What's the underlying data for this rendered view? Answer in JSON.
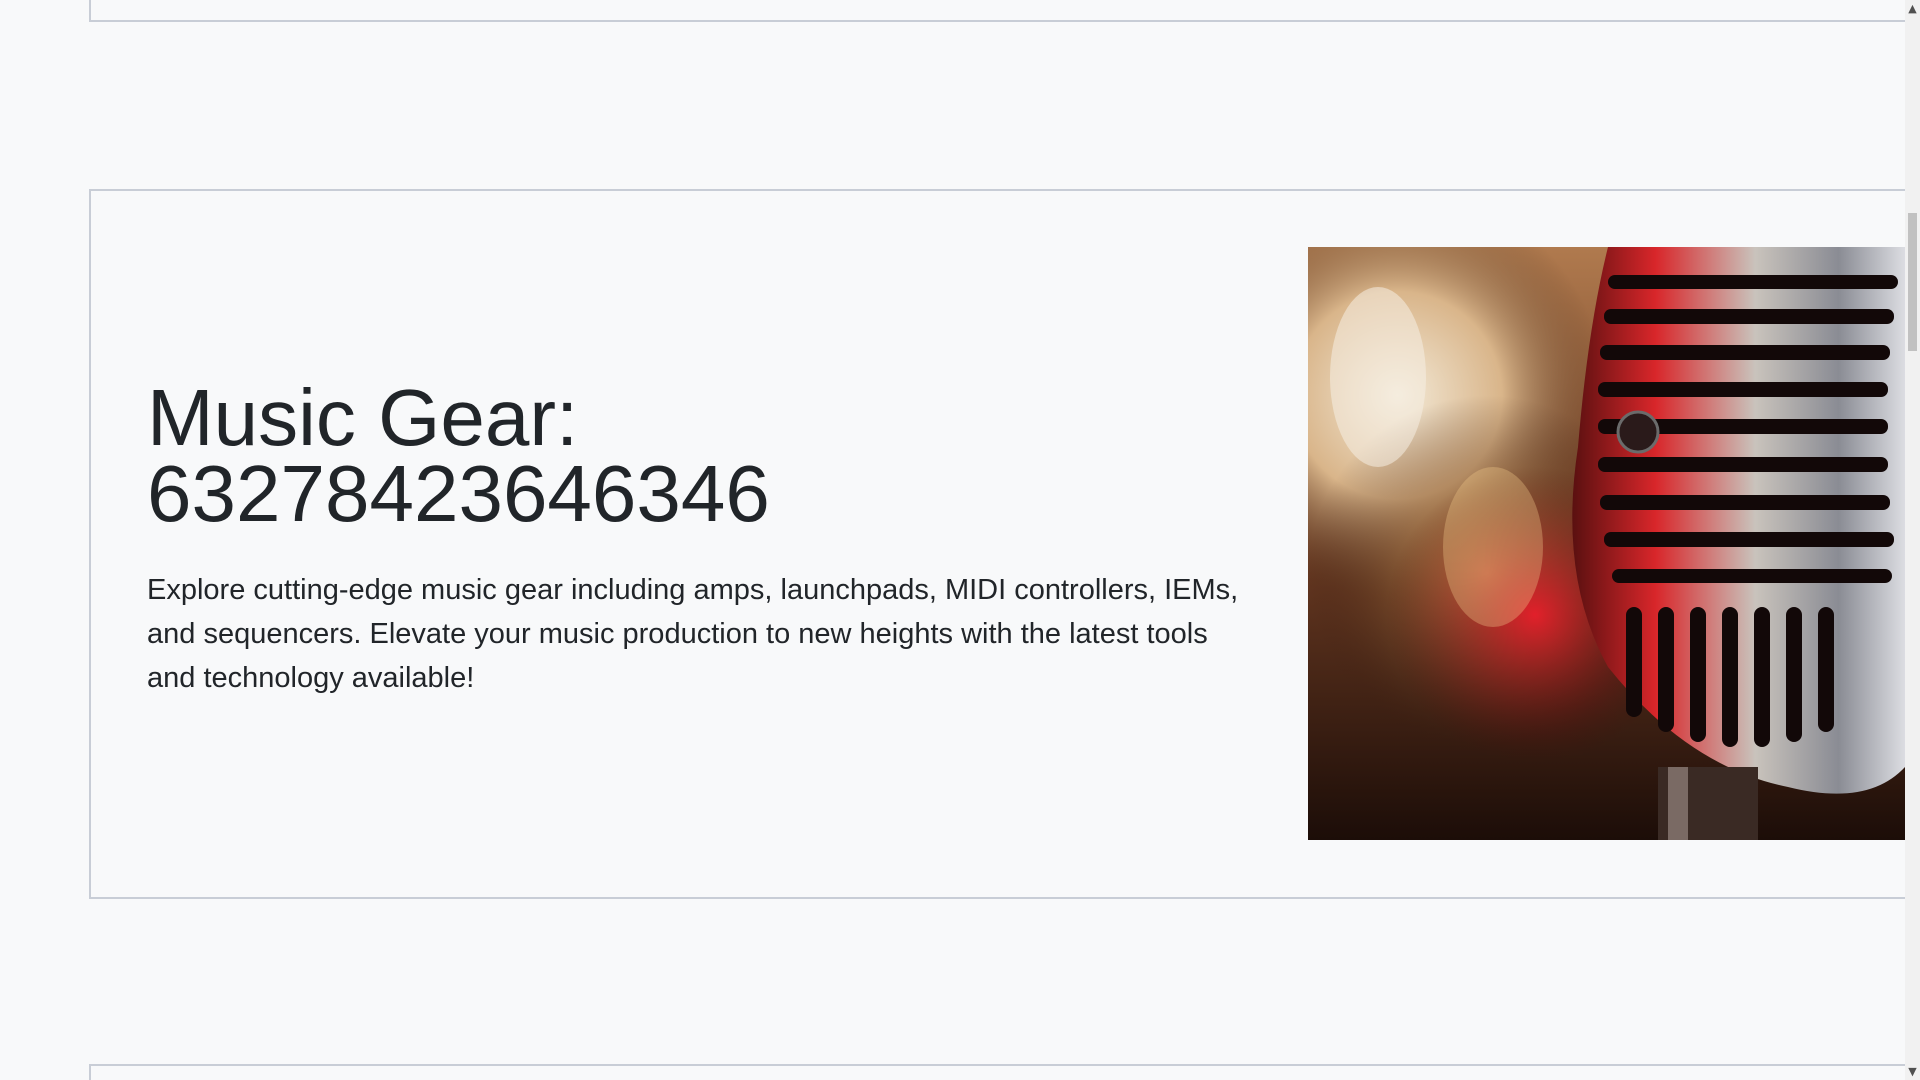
{
  "section": {
    "title_line1": "Music Gear:",
    "title_line2": "63278423646346",
    "description": "Explore cutting-edge music gear including amps, launchpads, MIDI controllers, IEMs, and sequencers. Elevate your music production to new heights with the latest tools and technology available!",
    "image_subject": "vintage-microphone"
  },
  "scrollbar": {
    "up_icon": "▲",
    "down_icon": "▼"
  },
  "colors": {
    "background": "#f8f9fa",
    "card_border": "#c8cdd6",
    "text": "#212529"
  }
}
